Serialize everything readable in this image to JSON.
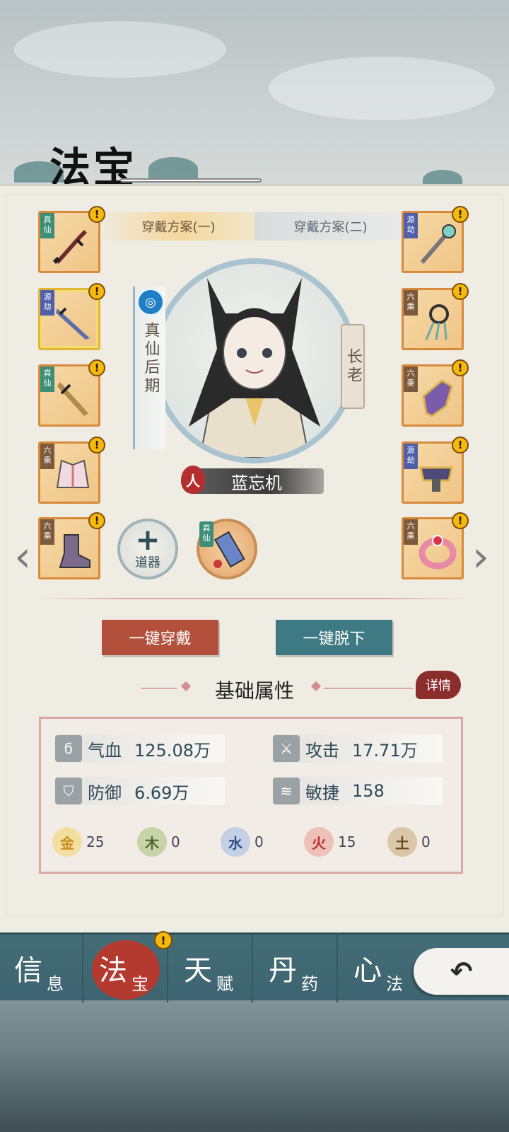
{
  "page": {
    "title": "法宝"
  },
  "tabs": [
    {
      "label": "穿戴方案(一)",
      "active": true
    },
    {
      "label": "穿戴方案(二)",
      "active": false
    }
  ],
  "character": {
    "realm": "真仙后期",
    "rank": "长老",
    "race": "人",
    "name": "蓝忘机"
  },
  "left_slots": [
    {
      "tag": "真仙",
      "tag_type": "zhenxian",
      "item": "sword-icon",
      "badge": "!"
    },
    {
      "tag": "源劫",
      "tag_type": "yuanjie",
      "item": "blade-icon",
      "badge": "!"
    },
    {
      "tag": "真仙",
      "tag_type": "zhenxian",
      "item": "dagger-icon",
      "badge": "!"
    },
    {
      "tag": "六乘",
      "tag_type": "liucheng",
      "item": "robe-icon",
      "badge": "!"
    },
    {
      "tag": "六乘",
      "tag_type": "liucheng",
      "item": "boot-icon",
      "badge": "!"
    }
  ],
  "right_slots": [
    {
      "tag": "源劫",
      "tag_type": "yuanjie",
      "item": "staff-icon",
      "badge": "!"
    },
    {
      "tag": "六乘",
      "tag_type": "liucheng",
      "item": "pendant-icon",
      "badge": "!"
    },
    {
      "tag": "六乘",
      "tag_type": "liucheng",
      "item": "gauntlet-icon",
      "badge": "!"
    },
    {
      "tag": "源劫",
      "tag_type": "yuanjie",
      "item": "belt-icon",
      "badge": "!"
    },
    {
      "tag": "六乘",
      "tag_type": "liucheng",
      "item": "ring-icon",
      "badge": "!"
    }
  ],
  "daoqi": {
    "plus": "+",
    "label": "道器"
  },
  "talisman": {
    "tag": "真仙"
  },
  "buttons": {
    "equip_all": "一键穿戴",
    "unequip_all": "一键脱下"
  },
  "attributes": {
    "section_title": "基础属性",
    "detail_label": "详情",
    "stats": [
      {
        "label": "气血",
        "value": "125.08万"
      },
      {
        "label": "攻击",
        "value": "17.71万"
      },
      {
        "label": "防御",
        "value": "6.69万"
      },
      {
        "label": "敏捷",
        "value": "158"
      }
    ],
    "elements": [
      {
        "glyph": "金",
        "value": "25",
        "color": "#e7b64e"
      },
      {
        "glyph": "木",
        "value": "0",
        "color": "#6f8a4a"
      },
      {
        "glyph": "水",
        "value": "0",
        "color": "#4f6fa8"
      },
      {
        "glyph": "火",
        "value": "15",
        "color": "#c9453a"
      },
      {
        "glyph": "土",
        "value": "0",
        "color": "#8a6a3f"
      }
    ]
  },
  "nav": [
    {
      "main": "信",
      "sub": "息"
    },
    {
      "main": "法",
      "sub": "宝",
      "active": true,
      "badge": "!"
    },
    {
      "main": "天",
      "sub": "赋"
    },
    {
      "main": "丹",
      "sub": "药"
    },
    {
      "main": "心",
      "sub": "法"
    }
  ],
  "back": {
    "glyph": "↶"
  },
  "colors": {
    "accent_red": "#b2503c",
    "accent_teal": "#3e7a83",
    "slot_border": "#d88a3a"
  }
}
